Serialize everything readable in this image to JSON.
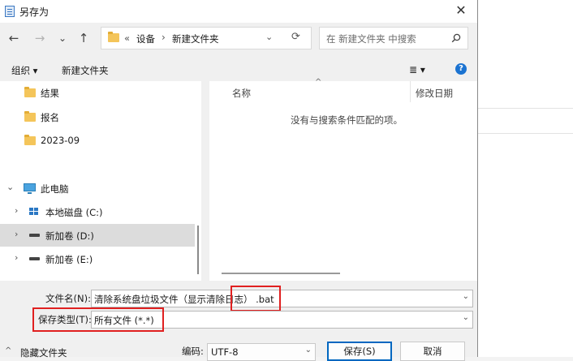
{
  "window": {
    "title": "另存为",
    "close_glyph": "✕"
  },
  "nav": {
    "back_glyph": "←",
    "forward_glyph": "→",
    "recent_glyph": "⌄",
    "up_glyph": "↑",
    "breadcrumb_overflow": "«",
    "breadcrumb": [
      "设备",
      "新建文件夹"
    ],
    "refresh_glyph": "⟳",
    "search_placeholder": "在 新建文件夹 中搜索"
  },
  "toolbar": {
    "organize": "组织 ▾",
    "new_folder": "新建文件夹",
    "view_glyph": "≣ ▾",
    "help": "?"
  },
  "tree": [
    {
      "label": "结果",
      "icon": "folder-icon"
    },
    {
      "label": "报名",
      "icon": "folder-icon"
    },
    {
      "label": "2023-09",
      "icon": "folder-icon"
    },
    {
      "label": "此电脑",
      "icon": "computer-icon",
      "arrow": "⌄"
    },
    {
      "label": "本地磁盘 (C:)",
      "icon": "system-drive-icon",
      "arrow": "›"
    },
    {
      "label": "新加卷 (D:)",
      "icon": "drive-icon",
      "arrow": "›",
      "selected": true
    },
    {
      "label": "新加卷 (E:)",
      "icon": "drive-icon",
      "arrow": "›"
    }
  ],
  "filepane": {
    "col_name": "名称",
    "col_modified": "修改日期",
    "empty_message": "没有与搜索条件匹配的项。"
  },
  "form": {
    "filename_label": "文件名(N):",
    "filename_value": "清除系统盘垃圾文件（显示清除日志）",
    "filename_ext": ".bat",
    "filetype_label": "保存类型(T):",
    "filetype_value": "所有文件 (*.*)",
    "hide_folders": "隐藏文件夹",
    "encoding_label": "编码:",
    "encoding_value": "UTF-8",
    "save_button": "保存(S)",
    "cancel_button": "取消"
  },
  "colors": {
    "highlight": "#e02020",
    "primary_border": "#0067c0",
    "folder": "#f4c55a"
  }
}
